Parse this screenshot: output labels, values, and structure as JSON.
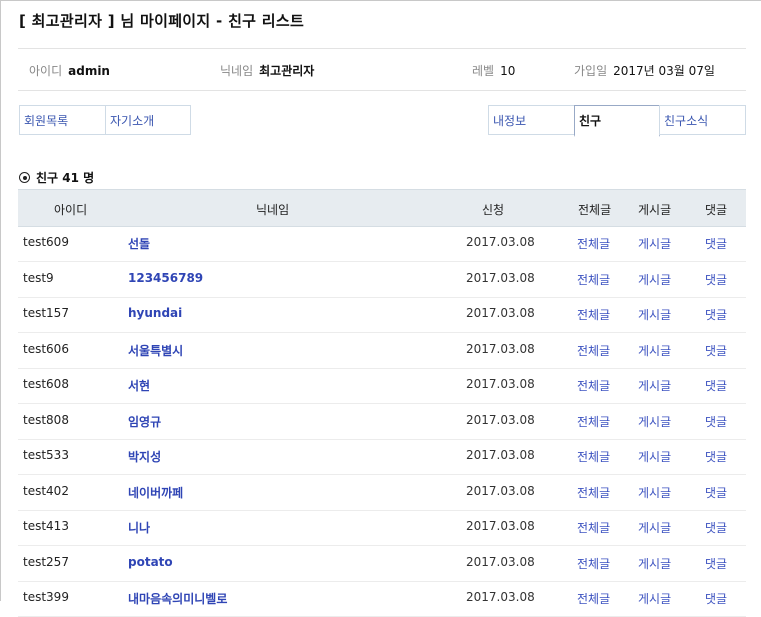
{
  "page": {
    "title": "[ 최고관리자 ] 님 마이페이지 - 친구 리스트"
  },
  "profile": {
    "id_label": "아이디",
    "id_value": "admin",
    "nick_label": "닉네임",
    "nick_value": "최고관리자",
    "level_label": "레벨",
    "level_value": "10",
    "join_label": "가입일",
    "join_value": "2017년 03월 07일"
  },
  "tabs": {
    "left": [
      "회원목록",
      "자기소개"
    ],
    "right": [
      "내정보",
      "친구",
      "친구소식"
    ],
    "active": "친구"
  },
  "friends": {
    "count_label": "친구 41 명"
  },
  "table": {
    "headers": {
      "id": "아이디",
      "nick": "닉네임",
      "date": "신청",
      "all": "전체글",
      "posts": "게시글",
      "comments": "댓글"
    },
    "rows": [
      {
        "id": "test609",
        "nick": "선돌",
        "date": "2017.03.08",
        "all": "전체글",
        "posts": "게시글",
        "comments": "댓글"
      },
      {
        "id": "test9",
        "nick": "123456789",
        "date": "2017.03.08",
        "all": "전체글",
        "posts": "게시글",
        "comments": "댓글"
      },
      {
        "id": "test157",
        "nick": "hyundai",
        "date": "2017.03.08",
        "all": "전체글",
        "posts": "게시글",
        "comments": "댓글"
      },
      {
        "id": "test606",
        "nick": "서울특별시",
        "date": "2017.03.08",
        "all": "전체글",
        "posts": "게시글",
        "comments": "댓글"
      },
      {
        "id": "test608",
        "nick": "서현",
        "date": "2017.03.08",
        "all": "전체글",
        "posts": "게시글",
        "comments": "댓글"
      },
      {
        "id": "test808",
        "nick": "임영규",
        "date": "2017.03.08",
        "all": "전체글",
        "posts": "게시글",
        "comments": "댓글"
      },
      {
        "id": "test533",
        "nick": "박지성",
        "date": "2017.03.08",
        "all": "전체글",
        "posts": "게시글",
        "comments": "댓글"
      },
      {
        "id": "test402",
        "nick": "네이버까페",
        "date": "2017.03.08",
        "all": "전체글",
        "posts": "게시글",
        "comments": "댓글"
      },
      {
        "id": "test413",
        "nick": "니나",
        "date": "2017.03.08",
        "all": "전체글",
        "posts": "게시글",
        "comments": "댓글"
      },
      {
        "id": "test257",
        "nick": "potato",
        "date": "2017.03.08",
        "all": "전체글",
        "posts": "게시글",
        "comments": "댓글"
      },
      {
        "id": "test399",
        "nick": "내마음속의미니벨로",
        "date": "2017.03.08",
        "all": "전체글",
        "posts": "게시글",
        "comments": "댓글"
      }
    ]
  }
}
